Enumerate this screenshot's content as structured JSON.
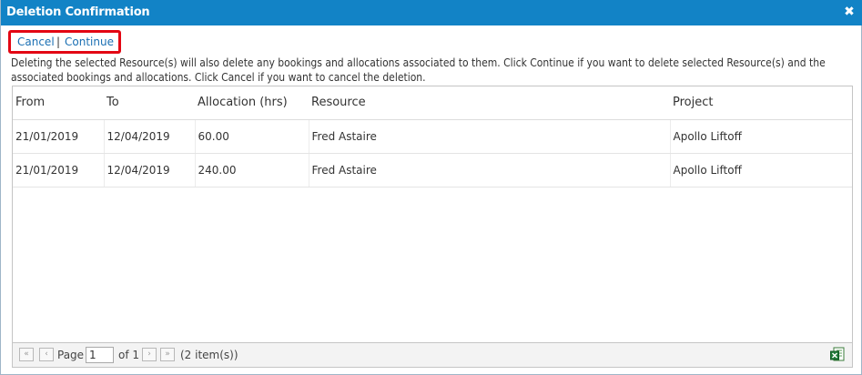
{
  "dialog": {
    "title": "Deletion Confirmation",
    "close_glyph": "✖"
  },
  "actions": {
    "cancel_label": "Cancel",
    "separator": "|",
    "continue_label": "Continue"
  },
  "message": "Deleting the selected Resource(s) will also delete any bookings and allocations associated to them. Click Continue if you want to delete selected Resource(s) and the associated bookings and allocations. Click Cancel if you want to cancel the deletion.",
  "table": {
    "columns": [
      "From",
      "To",
      "Allocation (hrs)",
      "Resource",
      "Project"
    ],
    "rows": [
      [
        "21/01/2019",
        "12/04/2019",
        "60.00",
        "Fred Astaire",
        "Apollo Liftoff"
      ],
      [
        "21/01/2019",
        "12/04/2019",
        "240.00",
        "Fred Astaire",
        "Apollo Liftoff"
      ]
    ]
  },
  "pager": {
    "first_glyph": "«",
    "prev_glyph": "‹",
    "next_glyph": "›",
    "last_glyph": "»",
    "page_label": "Page",
    "page_value": "1",
    "of_label": "of 1",
    "items_label": "(2 item(s))",
    "export_icon": "excel-export-icon"
  },
  "colors": {
    "titlebar": "#1283c6",
    "highlight_border": "#e30613",
    "link": "#1a6fb3"
  }
}
